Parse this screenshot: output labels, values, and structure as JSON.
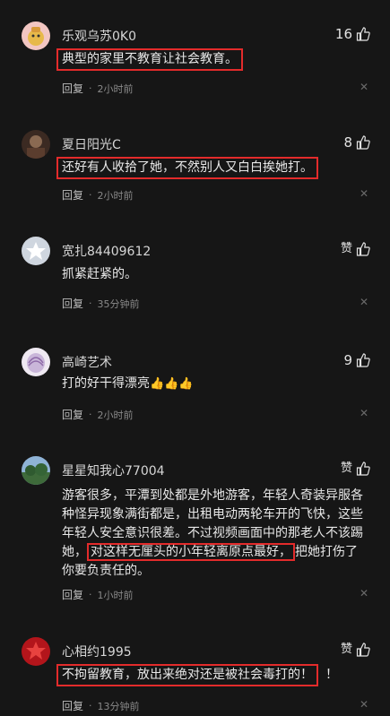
{
  "comments": [
    {
      "name": "乐观乌苏0K0",
      "likes": "16",
      "text": "典型的家里不教育让社会教育。",
      "reply": "回复",
      "time": "2小时前"
    },
    {
      "name": "夏日阳光C",
      "likes": "8",
      "text": "还好有人收拾了她，不然别人又白白挨她打。",
      "reply": "回复",
      "time": "2小时前"
    },
    {
      "name": "宽扎84409612",
      "likes": "赞",
      "text": "抓紧赶紧的。",
      "reply": "回复",
      "time": "35分钟前"
    },
    {
      "name": "高崎艺术",
      "likes": "9",
      "text": "打的好干得漂亮",
      "emoji": "👍👍👍",
      "reply": "回复",
      "time": "2小时前"
    },
    {
      "name": "星星知我心77004",
      "likes": "赞",
      "text_part1": "游客很多，平潭到处都是外地游客，年轻人奇装异服各种怪异现象满街都是，出租电动两轮车开的飞快，这些年轻人安全意识很差。不过视频画面中的那老人不该踢她，",
      "text_highlight": "对这样无厘头的小年轻离原点最好，",
      "text_part2": "把她打伤了你要负责任的。",
      "reply": "回复",
      "time": "1小时前"
    },
    {
      "name": "心相约1995",
      "likes": "赞",
      "text": "不拘留教育，放出来绝对还是被社会毒打的！",
      "text_tail": "！",
      "reply": "回复",
      "time": "13分钟前"
    }
  ],
  "icons": {
    "like": "thumbs-up-icon",
    "close": "close-icon"
  },
  "colors": {
    "highlight": "#e32b2b",
    "background": "#161616"
  }
}
